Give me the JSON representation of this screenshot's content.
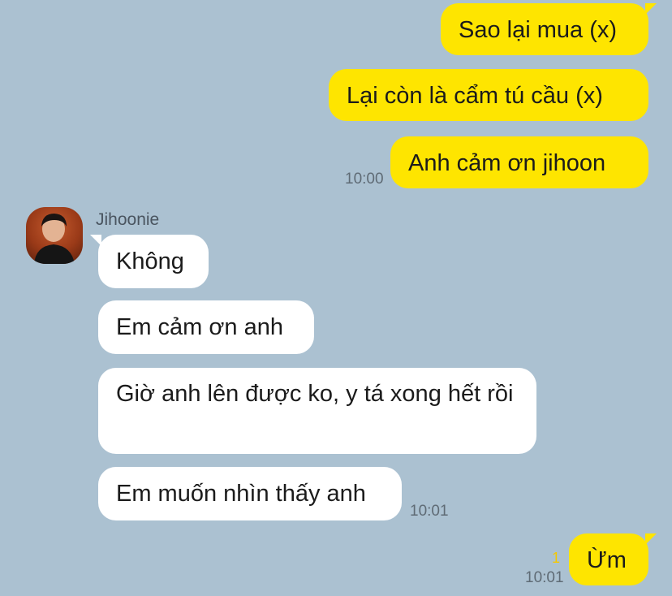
{
  "messages_out_top": [
    {
      "text": "Sao lại mua (x)"
    },
    {
      "text": "Lại còn là cẩm tú cầu (x)"
    },
    {
      "text": "Anh cảm ơn jihoon",
      "time": "10:00"
    }
  ],
  "contact": {
    "name": "Jihoonie"
  },
  "messages_in": [
    {
      "text": "Không"
    },
    {
      "text": "Em cảm ơn anh"
    },
    {
      "text": "Giờ anh lên được ko, y tá xong hết rồi"
    },
    {
      "text": "Em muốn nhìn thấy anh",
      "time": "10:01"
    }
  ],
  "message_out_bottom": {
    "text": "Ừm",
    "time": "10:01",
    "unread_count": "1"
  },
  "colors": {
    "background": "#abc1d1",
    "outgoing_bubble": "#fee500",
    "incoming_bubble": "#ffffff"
  }
}
